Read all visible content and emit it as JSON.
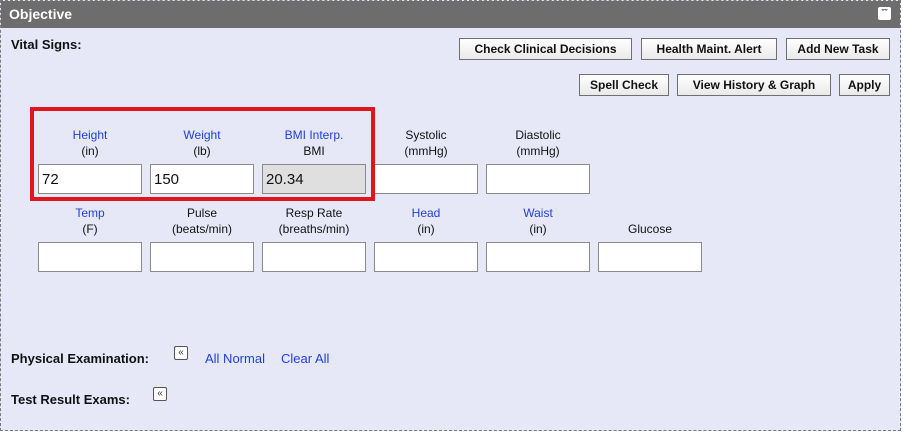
{
  "panel": {
    "title": "Objective"
  },
  "vitals": {
    "section_title": "Vital Signs:",
    "buttons": {
      "check_clinical": "Check Clinical Decisions",
      "health_alert": "Health Maint. Alert",
      "add_task": "Add New Task",
      "spell_check": "Spell Check",
      "view_history": "View History & Graph",
      "apply": "Apply"
    },
    "row1": [
      {
        "label": "Height",
        "unit": "(in)",
        "value": "72"
      },
      {
        "label": "Weight",
        "unit": "(lb)",
        "value": "150"
      },
      {
        "label": "BMI Interp.",
        "unit": "BMI",
        "value": "20.34"
      },
      {
        "label": "Systolic",
        "unit": "(mmHg)",
        "value": ""
      },
      {
        "label": "Diastolic",
        "unit": "(mmHg)",
        "value": ""
      }
    ],
    "row2": [
      {
        "label": "Temp",
        "unit": "(F)",
        "value": ""
      },
      {
        "label": "Pulse",
        "unit": "(beats/min)",
        "value": ""
      },
      {
        "label": "Resp Rate",
        "unit": "(breaths/min)",
        "value": ""
      },
      {
        "label": "Head",
        "unit": "(in)",
        "value": ""
      },
      {
        "label": "Waist",
        "unit": "(in)",
        "value": ""
      },
      {
        "label": "Glucose",
        "unit": "",
        "value": ""
      }
    ]
  },
  "physical_exam": {
    "label": "Physical Examination:",
    "all_normal": "All Normal",
    "clear_all": "Clear All"
  },
  "test_results": {
    "label": "Test Result Exams:"
  },
  "colors": {
    "highlight": "#e0161d",
    "link": "#1f3fd8",
    "panel_bg": "#e6e8f7",
    "titlebar": "#6d6d6d"
  }
}
